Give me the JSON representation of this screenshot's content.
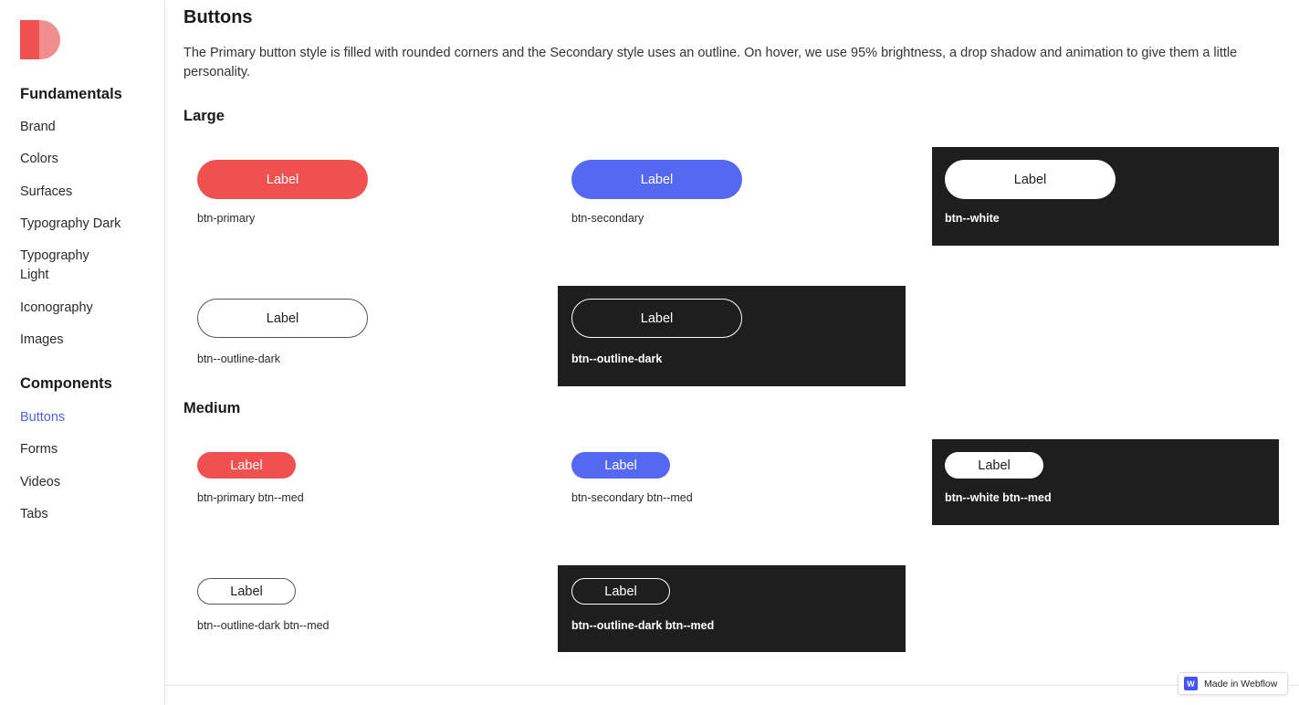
{
  "brand": {
    "primary": "#ef5050",
    "secondary": "#5468f1",
    "dark": "#1e1e1e",
    "nav_active": "#4f62e6"
  },
  "sidebar": {
    "sections": [
      {
        "heading": "Fundamentals",
        "items": [
          {
            "label": "Brand",
            "active": false
          },
          {
            "label": "Colors",
            "active": false
          },
          {
            "label": "Surfaces",
            "active": false
          },
          {
            "label": "Typography Dark",
            "active": false
          },
          {
            "label_line1": "Typography",
            "label_line2": "Light",
            "active": false
          },
          {
            "label": "Iconography",
            "active": false
          },
          {
            "label": "Images",
            "active": false
          }
        ]
      },
      {
        "heading": "Components",
        "items": [
          {
            "label": "Buttons",
            "active": true
          },
          {
            "label": "Forms",
            "active": false
          },
          {
            "label": "Videos",
            "active": false
          },
          {
            "label": "Tabs",
            "active": false
          }
        ]
      }
    ]
  },
  "main": {
    "title": "Buttons",
    "description": "The Primary button style is filled with rounded corners and the Secondary style uses an outline. On hover, we use 95% brightness, a drop shadow and animation to give them a little personality.",
    "large": {
      "heading": "Large",
      "examples": [
        {
          "label": "Label",
          "caption": "btn-primary"
        },
        {
          "label": "Label",
          "caption": "btn-secondary"
        },
        {
          "label": "Label",
          "caption": "btn--white"
        },
        {
          "label": "Label",
          "caption": "btn--outline-dark"
        },
        {
          "label": "Label",
          "caption": "btn--outline-dark"
        }
      ]
    },
    "medium": {
      "heading": "Medium",
      "examples": [
        {
          "label": "Label",
          "caption": "btn-primary btn--med"
        },
        {
          "label": "Label",
          "caption": "btn-secondary btn--med"
        },
        {
          "label": "Label",
          "caption": "btn--white btn--med"
        },
        {
          "label": "Label",
          "caption": "btn--outline-dark btn--med"
        },
        {
          "label": "Label",
          "caption": "btn--outline-dark btn--med"
        }
      ]
    }
  },
  "badge": {
    "icon": "webflow-icon",
    "icon_text": "W",
    "label": "Made in Webflow"
  }
}
